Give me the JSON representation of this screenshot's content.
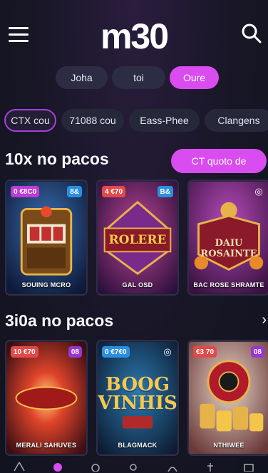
{
  "header": {
    "logo": "m30"
  },
  "segments": [
    {
      "label": "Joha",
      "active": false
    },
    {
      "label": "toi",
      "active": false
    },
    {
      "label": "Oure",
      "active": true
    }
  ],
  "chips": [
    {
      "label": "CTX cou",
      "active": true
    },
    {
      "label": "71088 cou",
      "active": false
    },
    {
      "label": "Eass-Phee",
      "active": false
    },
    {
      "label": "Clangens",
      "active": false
    }
  ],
  "section1": {
    "title": "10x no pacos",
    "cta": "CT quoto de",
    "cards": [
      {
        "badge": "0 €8C0",
        "badge_color": "#c03ad8",
        "badge2": "8&",
        "badge2_color": "#2b8fe0",
        "big": "",
        "name": "SOUING MCRO"
      },
      {
        "badge": "4 €70",
        "badge_color": "#e14a4a",
        "badge2": "B&",
        "badge2_color": "#2b8fe0",
        "big": "ROLERE",
        "name": "GAL OSD"
      },
      {
        "badge": "",
        "badge_color": "",
        "badge2": "◎",
        "badge2_color": "",
        "big": "DAIU ROSAINTE",
        "name": "BAC ROSE SHRAMTE"
      }
    ]
  },
  "section2": {
    "title": "3i0a no pacos",
    "arrow": "›",
    "cards": [
      {
        "badge": "10 €70",
        "badge_color": "#e14a4a",
        "badge2": "08",
        "badge2_color": "#9a36d0",
        "big": "",
        "name": "MERALI SAHUVES"
      },
      {
        "badge": "0 €7€0",
        "badge_color": "#2b8fe0",
        "badge2": "◎",
        "badge2_color": "",
        "big": "BOOG VINHIS",
        "name": "BLAGMACK"
      },
      {
        "badge": "€3 70",
        "badge_color": "#e14a4a",
        "badge2": "08",
        "badge2_color": "#9a36d0",
        "big": "",
        "name": "NTHIWEE"
      }
    ]
  },
  "bottom_nav": [
    "home-icon",
    "active-dot-icon",
    "casino-icon",
    "search-icon",
    "user-icon",
    "trophy-icon",
    "wallet-icon"
  ],
  "colors": {
    "accent": "#d94cf0",
    "background": "#171625",
    "chip": "#262738"
  }
}
